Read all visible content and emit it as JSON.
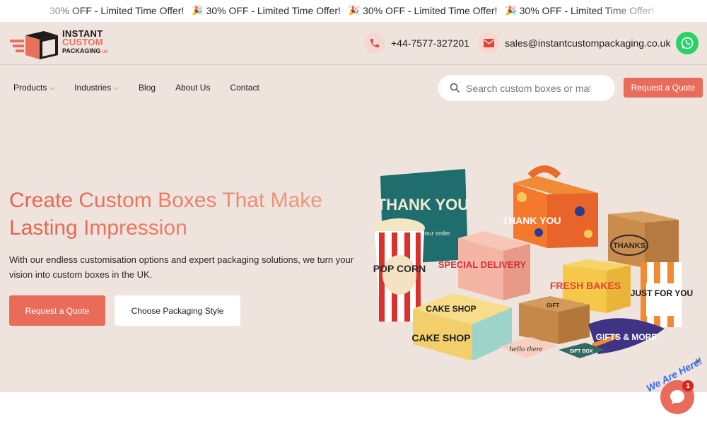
{
  "promo": {
    "items": [
      "30% OFF - Limited Time Offer!",
      "30% OFF - Limited Time Offer!",
      "30% OFF - Limited Time Offer!",
      "30% OFF - Limited Time Offer!"
    ]
  },
  "logo": {
    "line1": "INSTANT",
    "line2": "CUSTOM",
    "line3": "PACKAGING",
    "suffix": "UK"
  },
  "header": {
    "phone": "+44-7577-327201",
    "email": "sales@instantcustompackaging.co.uk"
  },
  "nav": {
    "items": [
      {
        "label": "Products",
        "dropdown": true
      },
      {
        "label": "Industries",
        "dropdown": true
      },
      {
        "label": "Blog",
        "dropdown": false
      },
      {
        "label": "About Us",
        "dropdown": false
      },
      {
        "label": "Contact",
        "dropdown": false
      }
    ]
  },
  "search": {
    "placeholder": "Search custom boxes or materials"
  },
  "top_quote_label": "Request a Quote",
  "hero": {
    "title": "Create Custom Boxes That Make Lasting Impression",
    "description": "With our endless customisation options and expert packaging solutions, we turn your vision into custom boxes in the UK.",
    "primary_button": "Request a Quote",
    "secondary_button": "Choose Packaging Style",
    "art_labels": {
      "thank_you": "THANK YOU",
      "for_your_order": "for your order",
      "popcorn": "POP CORN",
      "special_delivery": "SPECIAL DELIVERY",
      "thank_you_orange": "THANK YOU",
      "fresh_bakes": "FRESH BAKES",
      "thanks": "THANKS",
      "just_for_you": "JUST FOR YOU",
      "cake_shop_top": "CAKE SHOP",
      "cake_shop_side": "CAKE SHOP",
      "gift": "GIFT",
      "gifts_more": "GIFTS & MORE",
      "hello_there": "hello there",
      "gift_box": "GIFT BOX"
    }
  },
  "chat": {
    "tagline": "We Are Here!",
    "badge": "1",
    "close": "×"
  },
  "colors": {
    "accent": "#e96c5b",
    "hero_bg": "#efe3dd",
    "whatsapp": "#25d366"
  }
}
